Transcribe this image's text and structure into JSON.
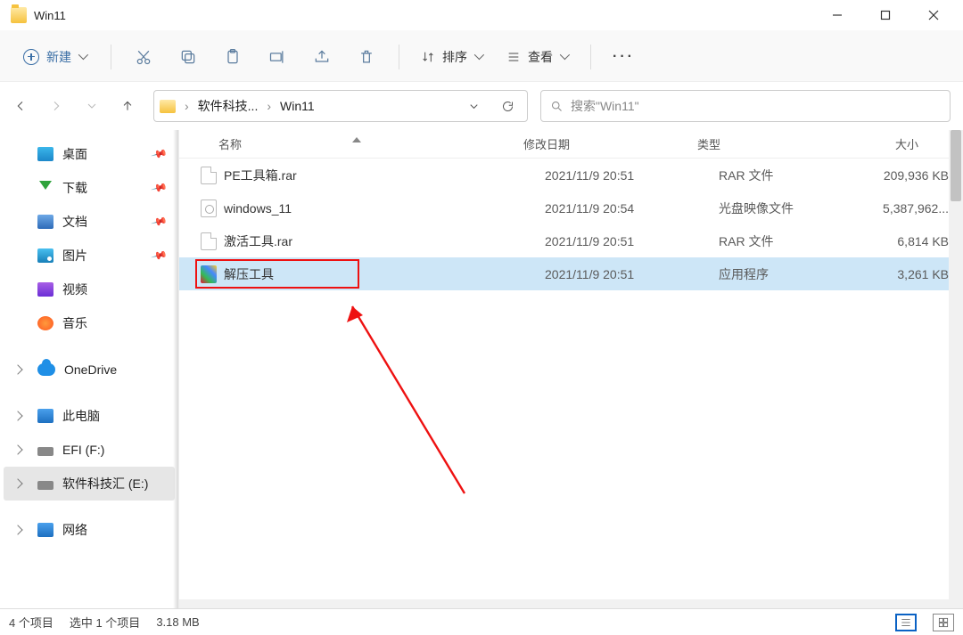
{
  "window": {
    "title": "Win11"
  },
  "toolbar": {
    "new_label": "新建",
    "sort_label": "排序",
    "view_label": "查看"
  },
  "breadcrumb": {
    "seg1": "软件科技...",
    "seg2": "Win11"
  },
  "search": {
    "placeholder": "搜索\"Win11\""
  },
  "sidebar": {
    "items": [
      {
        "label": "桌面"
      },
      {
        "label": "下载"
      },
      {
        "label": "文档"
      },
      {
        "label": "图片"
      },
      {
        "label": "视频"
      },
      {
        "label": "音乐"
      },
      {
        "label": "OneDrive"
      },
      {
        "label": "此电脑"
      },
      {
        "label": "EFI (F:)"
      },
      {
        "label": "软件科技汇 (E:)"
      },
      {
        "label": "网络"
      }
    ]
  },
  "columns": {
    "name": "名称",
    "date": "修改日期",
    "type": "类型",
    "size": "大小"
  },
  "files": [
    {
      "name": "PE工具箱.rar",
      "date": "2021/11/9 20:51",
      "type": "RAR 文件",
      "size": "209,936 KB"
    },
    {
      "name": "windows_11",
      "date": "2021/11/9 20:54",
      "type": "光盘映像文件",
      "size": "5,387,962..."
    },
    {
      "name": "激活工具.rar",
      "date": "2021/11/9 20:51",
      "type": "RAR 文件",
      "size": "6,814 KB"
    },
    {
      "name": "解压工具",
      "date": "2021/11/9 20:51",
      "type": "应用程序",
      "size": "3,261 KB"
    }
  ],
  "status": {
    "count": "4 个项目",
    "selection": "选中 1 个项目",
    "size": "3.18 MB"
  }
}
